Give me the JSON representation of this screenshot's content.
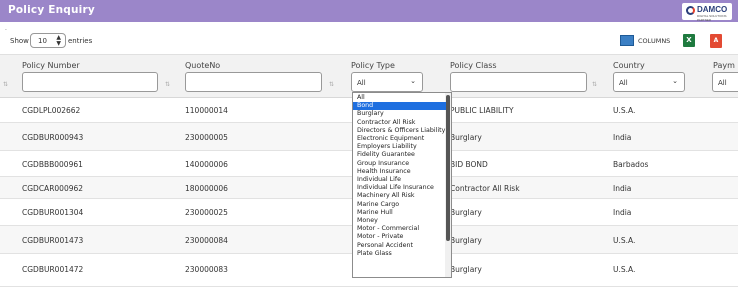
{
  "header": {
    "title": "Policy Enquiry",
    "logo_text": "DAMCO",
    "logo_sub": "DIGITAL SOLUTIONS PARTNER"
  },
  "misc": {
    "dot": "."
  },
  "length": {
    "show_label": "Show",
    "value": "10",
    "entries_label": "entries"
  },
  "toolbar": {
    "columns_label": "COLUMNS",
    "excel_label": "X",
    "pdf_label": "A"
  },
  "columns": [
    {
      "label": "Policy Number"
    },
    {
      "label": "QuoteNo"
    },
    {
      "label": "Policy Type",
      "filter_value": "All"
    },
    {
      "label": "Policy Class"
    },
    {
      "label": "Country",
      "filter_value": "All"
    },
    {
      "label": "Paym",
      "filter_value": "All"
    }
  ],
  "rows": [
    {
      "policy_number": "CGDLPL002662",
      "quote_no": "110000014",
      "policy_class": "PUBLIC LIABILITY",
      "country": "U.S.A."
    },
    {
      "policy_number": "CGDBUR000943",
      "quote_no": "230000005",
      "policy_class": "Burglary",
      "country": "India"
    },
    {
      "policy_number": "CGDBBB000961",
      "quote_no": "140000006",
      "policy_class": "BID BOND",
      "country": "Barbados"
    },
    {
      "policy_number": "CGDCAR000962",
      "quote_no": "180000006",
      "policy_class": "Contractor All Risk",
      "country": "India"
    },
    {
      "policy_number": "CGDBUR001304",
      "quote_no": "230000025",
      "policy_class": "Burglary",
      "country": "India"
    },
    {
      "policy_number": "CGDBUR001473",
      "quote_no": "230000084",
      "policy_class": "Burglary",
      "country": "U.S.A."
    },
    {
      "policy_number": "CGDBUR001472",
      "quote_no": "230000083",
      "policy_class": "Burglary",
      "country": "U.S.A."
    }
  ],
  "policy_type_dropdown": {
    "selected": "Bond",
    "options": [
      "All",
      "Bond",
      "Burglary",
      "Contractor All Risk",
      "Directors & Officers Liability",
      "Electronic Equipment",
      "Employers Liability",
      "Fidelity Guarantee",
      "Group Insurance",
      "Health Insurance",
      "Individual Life",
      "Individual Life Insurance",
      "Machinery All Risk",
      "Marine Cargo",
      "Marine Hull",
      "Money",
      "Motor - Commercial",
      "Motor - Private",
      "Personal Accident",
      "Plate Glass"
    ]
  }
}
